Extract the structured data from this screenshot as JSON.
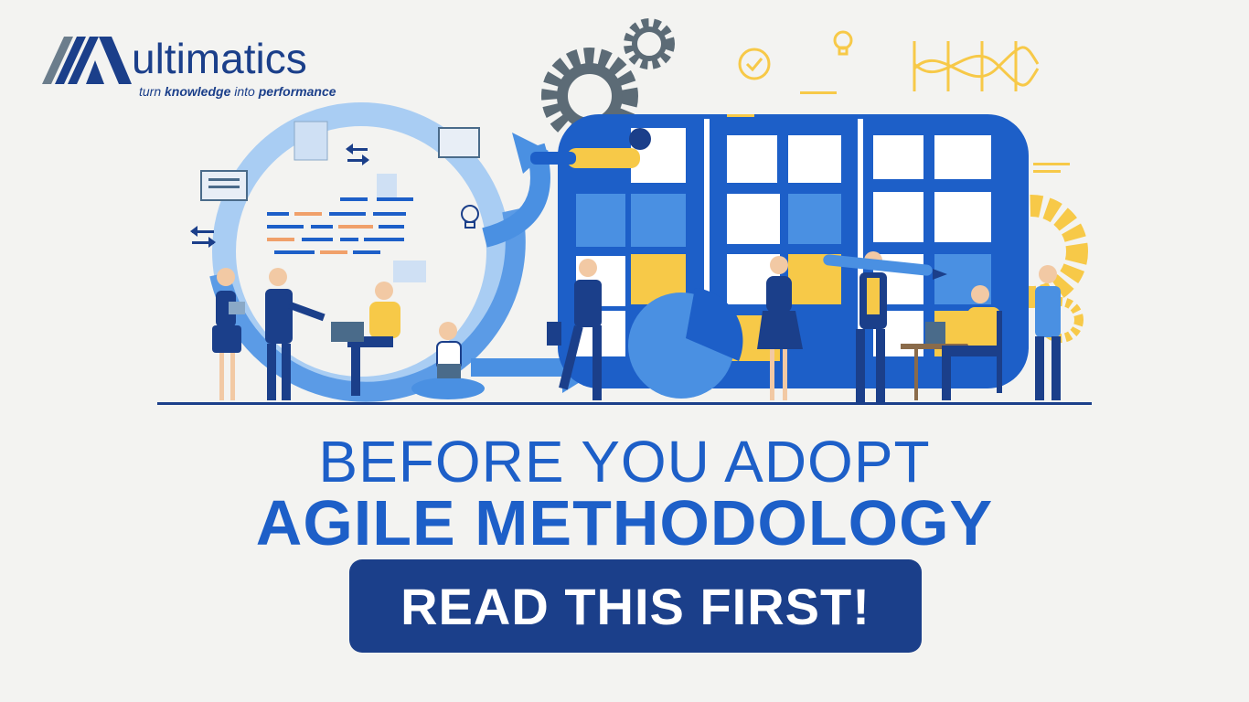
{
  "brand": {
    "name": "ultimatics",
    "tagline_pre": "turn ",
    "tagline_bold": "knowledge",
    "tagline_mid": " into ",
    "tagline_bold2": "performance"
  },
  "headline": {
    "line1": "BEFORE YOU ADOPT",
    "line2": "AGILE METHODOLOGY"
  },
  "cta": {
    "label": "READ THIS FIRST!"
  },
  "colors": {
    "background": "#f3f3f1",
    "primary_blue": "#1d5fc8",
    "navy": "#1b3f8a",
    "accent_yellow": "#f7c948",
    "light_blue": "#4a90e2"
  }
}
